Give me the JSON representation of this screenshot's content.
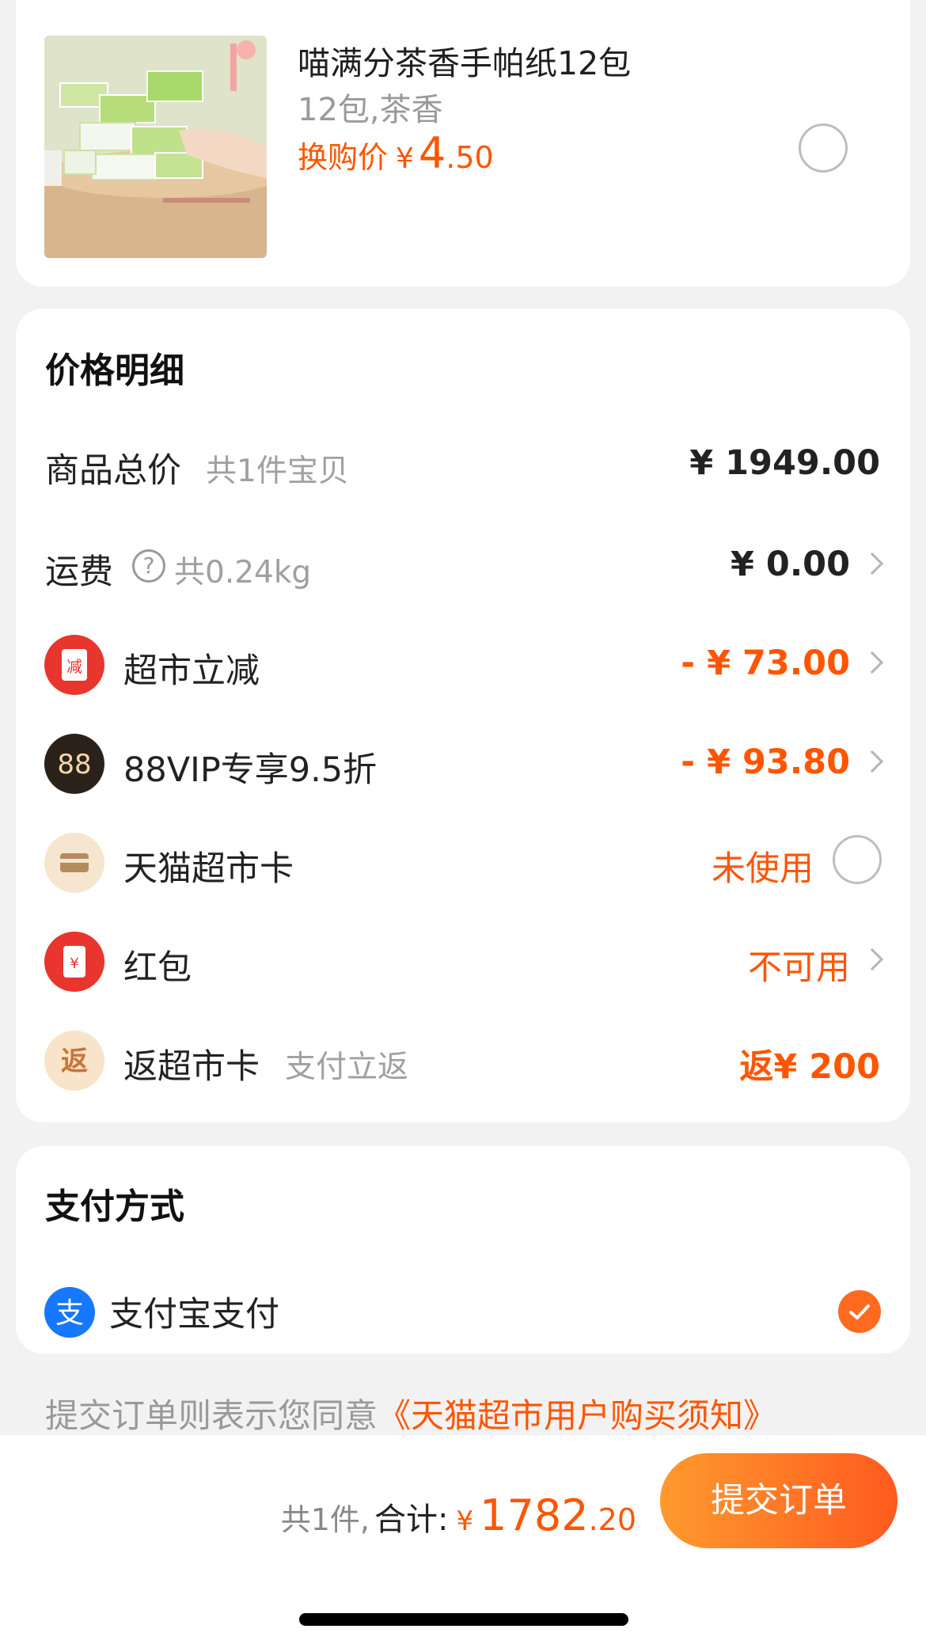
{
  "product": {
    "title": "喵满分茶香手帕纸12包",
    "spec": "12包,茶香",
    "price_label": "换购价",
    "currency": "¥",
    "price_int": "4",
    "price_dec": ".50",
    "selected": false
  },
  "price_detail": {
    "title": "价格明细",
    "rows": [
      {
        "label": "商品总价",
        "sub": "共1件宝贝",
        "value": "¥ 1949.00",
        "arrow": false,
        "icon": null
      },
      {
        "label": "运费",
        "sub": "共0.24kg",
        "help_icon": "question-circle-icon",
        "value": "¥ 0.00",
        "arrow": true
      },
      {
        "label": "超市立减",
        "icon": "discount-icon",
        "icon_text": "减",
        "value": "- ¥ 73.00",
        "arrow": true
      },
      {
        "label": "88VIP专享9.5折",
        "icon": "88vip-icon",
        "icon_text": "88",
        "value": "- ¥ 93.80",
        "arrow": true
      },
      {
        "label": "天猫超市卡",
        "icon": "card-icon",
        "value": "未使用",
        "radio": true
      },
      {
        "label": "红包",
        "icon": "red-packet-icon",
        "icon_text": "¥",
        "value": "不可用",
        "arrow": true
      },
      {
        "label": "返超市卡",
        "sub": "支付立返",
        "icon": "rebate-icon",
        "icon_text": "返",
        "value": "返¥ 200"
      }
    ]
  },
  "payment": {
    "title": "支付方式",
    "method": "支付宝支付",
    "icon": "alipay-icon",
    "icon_text": "支",
    "selected": true
  },
  "agreement": {
    "text": "提交订单则表示您同意",
    "link": "《天猫超市用户购买须知》"
  },
  "bottom_bar": {
    "count": "共1件,",
    "total_label": "合计:",
    "currency": "¥",
    "total_int": "1782",
    "total_dec": ".20",
    "submit_label": "提交订单"
  },
  "colors": {
    "accent": "#ff5500",
    "button_start": "#ff9a2e",
    "button_end": "#ff5a1f",
    "alipay": "#1677ff"
  }
}
